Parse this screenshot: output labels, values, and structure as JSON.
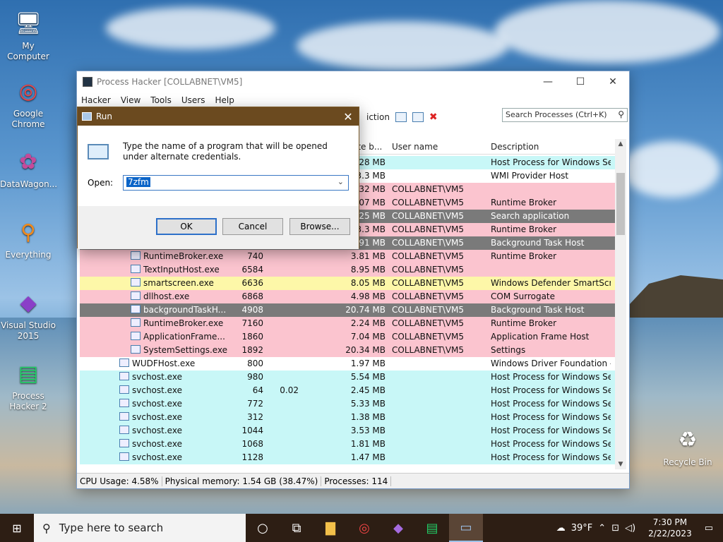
{
  "desktop": {
    "icons": [
      {
        "label": "My Computer",
        "glyph": "🖥"
      },
      {
        "label": "Google Chrome",
        "glyph": "◎"
      },
      {
        "label": "DataWagon...",
        "glyph": "✿"
      },
      {
        "label": "Everything",
        "glyph": "⚲"
      },
      {
        "label": "Visual Studio 2015",
        "glyph": "◆"
      },
      {
        "label": "Process Hacker 2",
        "glyph": "▤"
      },
      {
        "label": "Recycle Bin",
        "glyph": "♻"
      }
    ]
  },
  "process_hacker": {
    "title": "Process Hacker [COLLABNET\\VM5]",
    "menu": [
      "Hacker",
      "View",
      "Tools",
      "Users",
      "Help"
    ],
    "toolbar_partial": "iction",
    "search_placeholder": "Search Processes (Ctrl+K)",
    "headers": {
      "private": "ate b...",
      "user": "User name",
      "desc": "Description"
    },
    "rows": [
      {
        "name": "",
        "pid": "",
        "cpu": "",
        "mem": "28 MB",
        "user": "",
        "desc": "Host Process for Windows Ser...",
        "bg": "#c8f7f7",
        "indent": 0
      },
      {
        "name": "",
        "pid": "",
        "cpu": "",
        "mem": "3.3 MB",
        "user": "",
        "desc": "WMI Provider Host",
        "bg": "#ffffff",
        "indent": 0
      },
      {
        "name": "",
        "pid": "",
        "cpu": "",
        "mem": "32 MB",
        "user": "COLLABNET\\VM5",
        "desc": "",
        "bg": "#fbc4cf",
        "indent": 0
      },
      {
        "name": "",
        "pid": "",
        "cpu": "",
        "mem": "07 MB",
        "user": "COLLABNET\\VM5",
        "desc": "Runtime Broker",
        "bg": "#fbc4cf",
        "indent": 0
      },
      {
        "name": "",
        "pid": "",
        "cpu": "",
        "mem": "25 MB",
        "user": "COLLABNET\\VM5",
        "desc": "Search application",
        "bg": "#7a7a7a",
        "indent": 0
      },
      {
        "name": "",
        "pid": "",
        "cpu": "",
        "mem": "3.3 MB",
        "user": "COLLABNET\\VM5",
        "desc": "Runtime Broker",
        "bg": "#fbc4cf",
        "indent": 0
      },
      {
        "name": "",
        "pid": "",
        "cpu": "",
        "mem": "91 MB",
        "user": "COLLABNET\\VM5",
        "desc": "Background Task Host",
        "bg": "#7a7a7a",
        "indent": 0
      },
      {
        "name": "RuntimeBroker.exe",
        "pid": "740",
        "cpu": "",
        "mem": "3.81 MB",
        "user": "COLLABNET\\VM5",
        "desc": "Runtime Broker",
        "bg": "#fbc4cf",
        "indent": 2
      },
      {
        "name": "TextInputHost.exe",
        "pid": "6584",
        "cpu": "",
        "mem": "8.95 MB",
        "user": "COLLABNET\\VM5",
        "desc": "",
        "bg": "#fbc4cf",
        "indent": 2
      },
      {
        "name": "smartscreen.exe",
        "pid": "6636",
        "cpu": "",
        "mem": "8.05 MB",
        "user": "COLLABNET\\VM5",
        "desc": "Windows Defender SmartScre...",
        "bg": "#fdf7a8",
        "indent": 2
      },
      {
        "name": "dllhost.exe",
        "pid": "6868",
        "cpu": "",
        "mem": "4.98 MB",
        "user": "COLLABNET\\VM5",
        "desc": "COM Surrogate",
        "bg": "#fbc4cf",
        "indent": 2
      },
      {
        "name": "backgroundTaskH...",
        "pid": "4908",
        "cpu": "",
        "mem": "20.74 MB",
        "user": "COLLABNET\\VM5",
        "desc": "Background Task Host",
        "bg": "#7a7a7a",
        "indent": 2
      },
      {
        "name": "RuntimeBroker.exe",
        "pid": "7160",
        "cpu": "",
        "mem": "2.24 MB",
        "user": "COLLABNET\\VM5",
        "desc": "Runtime Broker",
        "bg": "#fbc4cf",
        "indent": 2
      },
      {
        "name": "ApplicationFrame...",
        "pid": "1860",
        "cpu": "",
        "mem": "7.04 MB",
        "user": "COLLABNET\\VM5",
        "desc": "Application Frame Host",
        "bg": "#fbc4cf",
        "indent": 2
      },
      {
        "name": "SystemSettings.exe",
        "pid": "1892",
        "cpu": "",
        "mem": "20.34 MB",
        "user": "COLLABNET\\VM5",
        "desc": "Settings",
        "bg": "#fbc4cf",
        "indent": 2
      },
      {
        "name": "WUDFHost.exe",
        "pid": "800",
        "cpu": "",
        "mem": "1.97 MB",
        "user": "",
        "desc": "Windows Driver Foundation - ...",
        "bg": "#ffffff",
        "indent": 1
      },
      {
        "name": "svchost.exe",
        "pid": "980",
        "cpu": "",
        "mem": "5.54 MB",
        "user": "",
        "desc": "Host Process for Windows Ser...",
        "bg": "#c8f7f7",
        "indent": 1
      },
      {
        "name": "svchost.exe",
        "pid": "64",
        "cpu": "0.02",
        "mem": "2.45 MB",
        "user": "",
        "desc": "Host Process for Windows Ser...",
        "bg": "#c8f7f7",
        "indent": 1
      },
      {
        "name": "svchost.exe",
        "pid": "772",
        "cpu": "",
        "mem": "5.33 MB",
        "user": "",
        "desc": "Host Process for Windows Ser...",
        "bg": "#c8f7f7",
        "indent": 1
      },
      {
        "name": "svchost.exe",
        "pid": "312",
        "cpu": "",
        "mem": "1.38 MB",
        "user": "",
        "desc": "Host Process for Windows Ser...",
        "bg": "#c8f7f7",
        "indent": 1
      },
      {
        "name": "svchost.exe",
        "pid": "1044",
        "cpu": "",
        "mem": "3.53 MB",
        "user": "",
        "desc": "Host Process for Windows Ser...",
        "bg": "#c8f7f7",
        "indent": 1
      },
      {
        "name": "svchost.exe",
        "pid": "1068",
        "cpu": "",
        "mem": "1.81 MB",
        "user": "",
        "desc": "Host Process for Windows Ser...",
        "bg": "#c8f7f7",
        "indent": 1
      },
      {
        "name": "svchost.exe",
        "pid": "1128",
        "cpu": "",
        "mem": "1.47 MB",
        "user": "",
        "desc": "Host Process for Windows Ser...",
        "bg": "#c8f7f7",
        "indent": 1
      }
    ],
    "status": {
      "cpu": "CPU Usage: 4.58%",
      "mem": "Physical memory: 1.54 GB (38.47%)",
      "procs": "Processes: 114"
    }
  },
  "run_dialog": {
    "title": "Run",
    "description": "Type the name of a program that will be opened under alternate credentials.",
    "open_label": "Open:",
    "input_value": "7zfm",
    "ok": "OK",
    "cancel": "Cancel",
    "browse": "Browse..."
  },
  "taskbar": {
    "search_placeholder": "Type here to search",
    "weather": "39°F",
    "time": "7:30 PM",
    "date": "2/22/2023"
  }
}
